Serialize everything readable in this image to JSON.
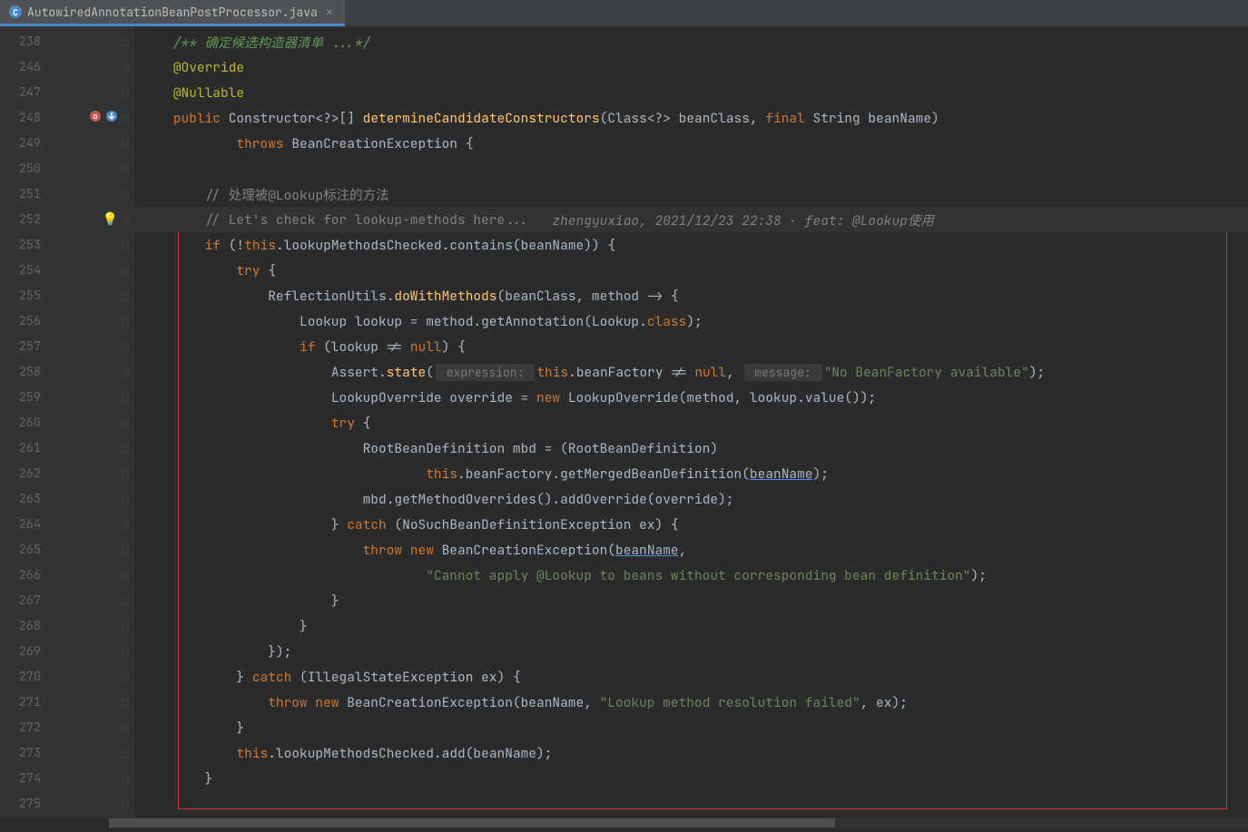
{
  "tab": {
    "filename": "AutowiredAnnotationBeanPostProcessor.java",
    "icon_letter": "C"
  },
  "lines": [
    {
      "num": "238",
      "parts": [
        {
          "text": "    ",
          "cls": ""
        },
        {
          "text": "/** 确定候选构造器清单 ...*/",
          "cls": "c-doc"
        }
      ]
    },
    {
      "num": "246",
      "parts": [
        {
          "text": "    ",
          "cls": ""
        },
        {
          "text": "@Override",
          "cls": "c-annotation"
        }
      ]
    },
    {
      "num": "247",
      "parts": [
        {
          "text": "    ",
          "cls": ""
        },
        {
          "text": "@Nullable",
          "cls": "c-annotation"
        }
      ]
    },
    {
      "num": "248",
      "parts": [
        {
          "text": "    ",
          "cls": ""
        },
        {
          "text": "public ",
          "cls": "c-keyword"
        },
        {
          "text": "Constructor<?>[] ",
          "cls": "c-type"
        },
        {
          "text": "determineCandidateConstructors",
          "cls": "c-method"
        },
        {
          "text": "(Class<?> beanClass, ",
          "cls": "c-plain"
        },
        {
          "text": "final ",
          "cls": "c-keyword"
        },
        {
          "text": "String beanName)",
          "cls": "c-plain"
        }
      ],
      "icons": [
        "override",
        "impl"
      ]
    },
    {
      "num": "249",
      "parts": [
        {
          "text": "            ",
          "cls": ""
        },
        {
          "text": "throws ",
          "cls": "c-keyword"
        },
        {
          "text": "BeanCreationException {",
          "cls": "c-plain"
        }
      ]
    },
    {
      "num": "250",
      "parts": []
    },
    {
      "num": "251",
      "parts": [
        {
          "text": "        ",
          "cls": ""
        },
        {
          "text": "// 处理被@Lookup标注的方法",
          "cls": "c-comment"
        }
      ]
    },
    {
      "num": "252",
      "highlight": true,
      "bulb": true,
      "parts": [
        {
          "text": "        ",
          "cls": ""
        },
        {
          "text": "// Let's check for lookup-methods here...",
          "cls": "c-comment"
        },
        {
          "text": "   zhengyuxiao, 2021/12/23 22:38 · feat: @Lookup使用",
          "cls": "c-annotation-txt"
        }
      ]
    },
    {
      "num": "253",
      "parts": [
        {
          "text": "        ",
          "cls": ""
        },
        {
          "text": "if ",
          "cls": "c-keyword"
        },
        {
          "text": "(!",
          "cls": "c-plain"
        },
        {
          "text": "this",
          "cls": "c-keyword"
        },
        {
          "text": ".lookupMethodsChecked.contains(beanName)) {",
          "cls": "c-plain"
        }
      ]
    },
    {
      "num": "254",
      "parts": [
        {
          "text": "            ",
          "cls": ""
        },
        {
          "text": "try ",
          "cls": "c-keyword"
        },
        {
          "text": "{",
          "cls": "c-plain"
        }
      ]
    },
    {
      "num": "255",
      "parts": [
        {
          "text": "                ",
          "cls": ""
        },
        {
          "text": "ReflectionUtils.",
          "cls": "c-plain"
        },
        {
          "text": "doWithMethods",
          "cls": "c-method"
        },
        {
          "text": "(beanClass, method -> {",
          "cls": "c-plain"
        }
      ]
    },
    {
      "num": "256",
      "parts": [
        {
          "text": "                    ",
          "cls": ""
        },
        {
          "text": "Lookup lookup = method.getAnnotation(Lookup.",
          "cls": "c-plain"
        },
        {
          "text": "class",
          "cls": "c-keyword"
        },
        {
          "text": ");",
          "cls": "c-plain"
        }
      ]
    },
    {
      "num": "257",
      "parts": [
        {
          "text": "                    ",
          "cls": ""
        },
        {
          "text": "if ",
          "cls": "c-keyword"
        },
        {
          "text": "(lookup != ",
          "cls": "c-plain"
        },
        {
          "text": "null",
          "cls": "c-keyword"
        },
        {
          "text": ") {",
          "cls": "c-plain"
        }
      ]
    },
    {
      "num": "258",
      "parts": [
        {
          "text": "                        ",
          "cls": ""
        },
        {
          "text": "Assert.",
          "cls": "c-plain"
        },
        {
          "text": "state",
          "cls": "c-method"
        },
        {
          "text": "(",
          "cls": "c-plain"
        },
        {
          "text": " expression: ",
          "cls": "c-hint"
        },
        {
          "text": "this",
          "cls": "c-keyword"
        },
        {
          "text": ".beanFactory != ",
          "cls": "c-plain"
        },
        {
          "text": "null",
          "cls": "c-keyword"
        },
        {
          "text": ", ",
          "cls": "c-plain"
        },
        {
          "text": " message: ",
          "cls": "c-hint"
        },
        {
          "text": "\"No BeanFactory available\"",
          "cls": "c-string"
        },
        {
          "text": ");",
          "cls": "c-plain"
        }
      ]
    },
    {
      "num": "259",
      "parts": [
        {
          "text": "                        ",
          "cls": ""
        },
        {
          "text": "LookupOverride override = ",
          "cls": "c-plain"
        },
        {
          "text": "new ",
          "cls": "c-keyword"
        },
        {
          "text": "LookupOverride(method, lookup.value());",
          "cls": "c-plain"
        }
      ]
    },
    {
      "num": "260",
      "parts": [
        {
          "text": "                        ",
          "cls": ""
        },
        {
          "text": "try ",
          "cls": "c-keyword"
        },
        {
          "text": "{",
          "cls": "c-plain"
        }
      ]
    },
    {
      "num": "261",
      "parts": [
        {
          "text": "                            ",
          "cls": ""
        },
        {
          "text": "RootBeanDefinition mbd = (RootBeanDefinition)",
          "cls": "c-plain"
        }
      ]
    },
    {
      "num": "262",
      "parts": [
        {
          "text": "                                    ",
          "cls": ""
        },
        {
          "text": "this",
          "cls": "c-keyword"
        },
        {
          "text": ".beanFactory.getMergedBeanDefinition(",
          "cls": "c-plain"
        },
        {
          "text": "beanName",
          "cls": "c-under"
        },
        {
          "text": ");",
          "cls": "c-plain"
        }
      ]
    },
    {
      "num": "263",
      "parts": [
        {
          "text": "                            ",
          "cls": ""
        },
        {
          "text": "mbd.getMethodOverrides().addOverride(override);",
          "cls": "c-plain"
        }
      ]
    },
    {
      "num": "264",
      "parts": [
        {
          "text": "                        ",
          "cls": ""
        },
        {
          "text": "} ",
          "cls": "c-plain"
        },
        {
          "text": "catch ",
          "cls": "c-keyword"
        },
        {
          "text": "(NoSuchBeanDefinitionException ex) {",
          "cls": "c-plain"
        }
      ]
    },
    {
      "num": "265",
      "parts": [
        {
          "text": "                            ",
          "cls": ""
        },
        {
          "text": "throw new ",
          "cls": "c-keyword"
        },
        {
          "text": "BeanCreationException(",
          "cls": "c-plain"
        },
        {
          "text": "beanName",
          "cls": "c-under"
        },
        {
          "text": ",",
          "cls": "c-plain"
        }
      ]
    },
    {
      "num": "266",
      "parts": [
        {
          "text": "                                    ",
          "cls": ""
        },
        {
          "text": "\"Cannot apply @Lookup to beans without corresponding bean definition\"",
          "cls": "c-string"
        },
        {
          "text": ");",
          "cls": "c-plain"
        }
      ]
    },
    {
      "num": "267",
      "parts": [
        {
          "text": "                        ",
          "cls": ""
        },
        {
          "text": "}",
          "cls": "c-plain"
        }
      ]
    },
    {
      "num": "268",
      "parts": [
        {
          "text": "                    ",
          "cls": ""
        },
        {
          "text": "}",
          "cls": "c-plain"
        }
      ]
    },
    {
      "num": "269",
      "parts": [
        {
          "text": "                ",
          "cls": ""
        },
        {
          "text": "});",
          "cls": "c-plain"
        }
      ]
    },
    {
      "num": "270",
      "parts": [
        {
          "text": "            ",
          "cls": ""
        },
        {
          "text": "} ",
          "cls": "c-plain"
        },
        {
          "text": "catch ",
          "cls": "c-keyword"
        },
        {
          "text": "(IllegalStateException ex) {",
          "cls": "c-plain"
        }
      ]
    },
    {
      "num": "271",
      "parts": [
        {
          "text": "                ",
          "cls": ""
        },
        {
          "text": "throw new ",
          "cls": "c-keyword"
        },
        {
          "text": "BeanCreationException(beanName, ",
          "cls": "c-plain"
        },
        {
          "text": "\"Lookup method resolution failed\"",
          "cls": "c-string"
        },
        {
          "text": ", ex);",
          "cls": "c-plain"
        }
      ]
    },
    {
      "num": "272",
      "parts": [
        {
          "text": "            ",
          "cls": ""
        },
        {
          "text": "}",
          "cls": "c-plain"
        }
      ]
    },
    {
      "num": "273",
      "parts": [
        {
          "text": "            ",
          "cls": ""
        },
        {
          "text": "this",
          "cls": "c-keyword"
        },
        {
          "text": ".lookupMethodsChecked.add(beanName);",
          "cls": "c-plain"
        }
      ]
    },
    {
      "num": "274",
      "parts": [
        {
          "text": "        ",
          "cls": ""
        },
        {
          "text": "}",
          "cls": "c-plain"
        }
      ]
    },
    {
      "num": "275",
      "parts": []
    }
  ]
}
